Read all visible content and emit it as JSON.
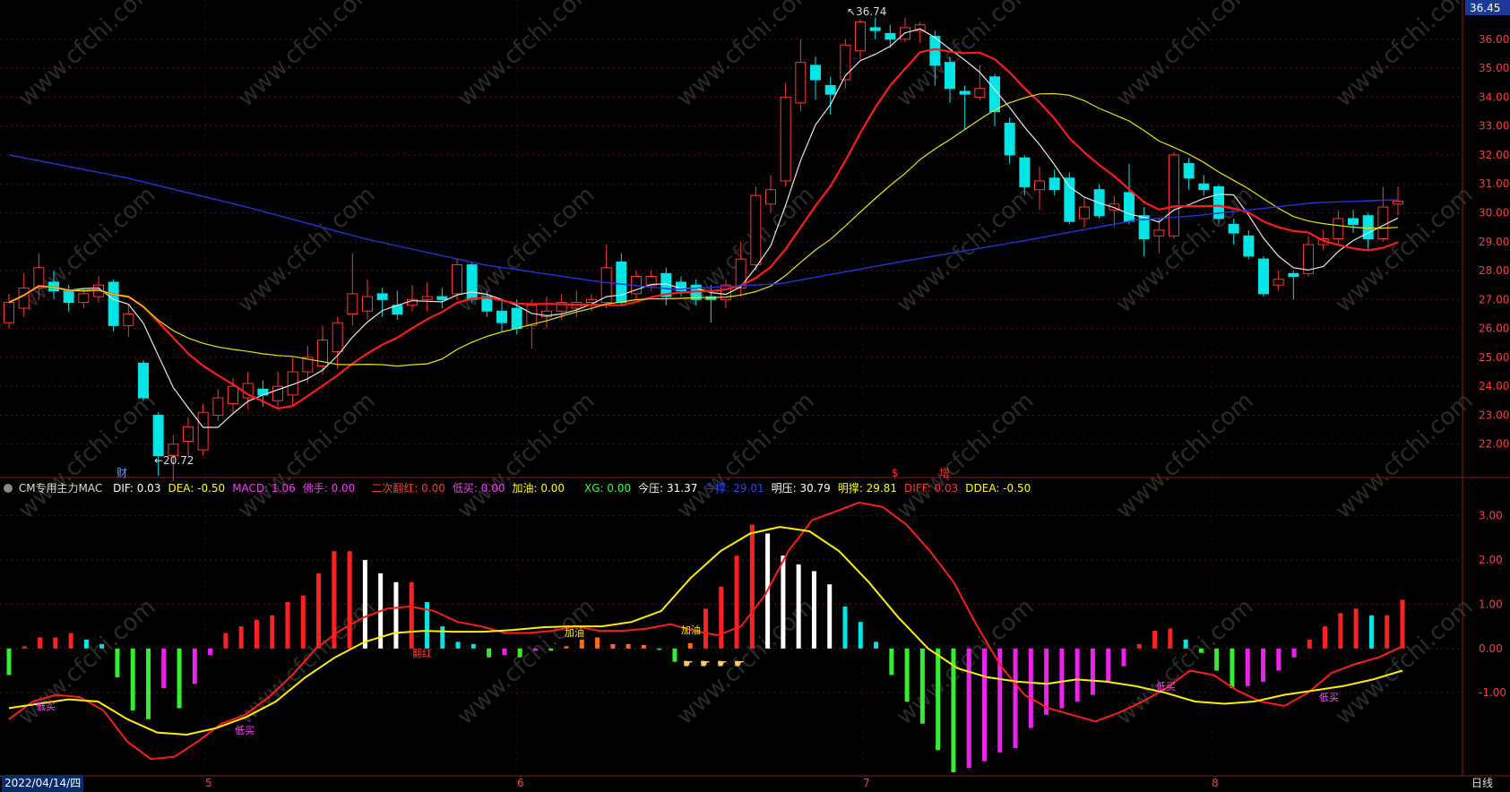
{
  "colors": {
    "up": "#ff3333",
    "down": "#00e5e5",
    "ma_white": "#e8e8e8",
    "ma_red": "#ff1a1a",
    "ma_yellow": "#e6e600",
    "ma_blue": "#2233dd",
    "grid": "#5a0f0f",
    "axis_text": "#ff3b3b"
  },
  "price_panel": {
    "current_price": "36.45",
    "y_ticks": [
      "36.00",
      "35.00",
      "34.00",
      "33.00",
      "32.00",
      "31.00",
      "30.00",
      "29.00",
      "28.00",
      "27.00",
      "26.00",
      "25.00",
      "24.00",
      "23.00",
      "22.00"
    ],
    "high_marker": "36.74",
    "low_marker": "20.72",
    "markers": [
      "财",
      "$",
      "增"
    ]
  },
  "indicator_panel": {
    "name": "CM专用主力MAC",
    "items": [
      {
        "label": "DIF: 0.03",
        "color": "#ffffff"
      },
      {
        "label": "DEA: -0.50",
        "color": "#ffff00"
      },
      {
        "label": "MACD: 1.06",
        "color": "#ff33ff"
      },
      {
        "label": "佛手: 0.00",
        "color": "#ff33ff"
      },
      {
        "label": "二次翻红: 0.00",
        "color": "#ff3333"
      },
      {
        "label": "低买: 0.00",
        "color": "#ff33ff"
      },
      {
        "label": "加油: 0.00",
        "color": "#ffff00"
      },
      {
        "label": "XG: 0.00",
        "color": "#33ff33"
      },
      {
        "label": "今压: 31.37",
        "color": "#ffffff"
      },
      {
        "label": "今撑: 29.01",
        "color": "#2244ff"
      },
      {
        "label": "明压: 30.79",
        "color": "#ffffff"
      },
      {
        "label": "明撑: 29.81",
        "color": "#ffff00"
      },
      {
        "label": "DIFF: 0.03",
        "color": "#ff3333"
      },
      {
        "label": "DDEA: -0.50",
        "color": "#ffff00"
      }
    ],
    "y_ticks": [
      "3.00",
      "2.00",
      "1.00",
      "0.00",
      "-1.00"
    ],
    "signals": [
      "低买",
      "低买",
      "翻红",
      "加油",
      "加油",
      "低买",
      "低买"
    ]
  },
  "footer": {
    "date": "2022/04/14/四",
    "months": [
      "5",
      "6",
      "7",
      "8"
    ],
    "period": "日线"
  },
  "watermark": "www.cfchi.com",
  "chart_data": {
    "type": "candlestick",
    "title": "",
    "price_ylim": [
      21.0,
      36.8
    ],
    "candles": [
      [
        26.2,
        26.9,
        27.2,
        26.0
      ],
      [
        26.7,
        27.4,
        27.9,
        26.4
      ],
      [
        27.4,
        28.1,
        28.6,
        27.0
      ],
      [
        27.6,
        27.3,
        28.0,
        27.0
      ],
      [
        27.3,
        26.9,
        27.5,
        26.6
      ],
      [
        26.9,
        27.2,
        27.4,
        26.7
      ],
      [
        27.1,
        27.5,
        27.8,
        26.9
      ],
      [
        27.6,
        26.1,
        27.7,
        25.9
      ],
      [
        26.1,
        26.5,
        26.8,
        25.7
      ],
      [
        24.8,
        23.6,
        24.9,
        23.5
      ],
      [
        23.0,
        21.6,
        23.1,
        20.9
      ],
      [
        21.6,
        22.0,
        22.3,
        20.72
      ],
      [
        22.1,
        22.6,
        22.9,
        21.6
      ],
      [
        21.8,
        23.1,
        23.4,
        21.6
      ],
      [
        23.0,
        23.6,
        23.9,
        22.8
      ],
      [
        23.4,
        24.0,
        24.3,
        23.1
      ],
      [
        23.6,
        24.1,
        24.5,
        23.2
      ],
      [
        23.9,
        23.7,
        24.2,
        23.3
      ],
      [
        23.5,
        24.0,
        24.5,
        23.2
      ],
      [
        23.7,
        24.5,
        25.0,
        23.3
      ],
      [
        24.5,
        25.0,
        25.4,
        24.1
      ],
      [
        24.7,
        25.6,
        26.1,
        24.4
      ],
      [
        25.2,
        26.2,
        26.4,
        24.6
      ],
      [
        26.5,
        27.2,
        28.6,
        26.1
      ],
      [
        26.6,
        27.1,
        27.7,
        26.3
      ],
      [
        27.2,
        27.0,
        27.4,
        26.4
      ],
      [
        26.8,
        26.5,
        27.3,
        26.3
      ],
      [
        26.8,
        27.0,
        27.5,
        26.6
      ],
      [
        27.0,
        27.1,
        27.6,
        26.6
      ],
      [
        27.1,
        27.0,
        27.4,
        26.7
      ],
      [
        27.2,
        28.2,
        28.4,
        27.0
      ],
      [
        28.2,
        27.0,
        28.3,
        26.9
      ],
      [
        27.1,
        26.6,
        27.3,
        26.4
      ],
      [
        26.6,
        26.2,
        27.0,
        25.9
      ],
      [
        26.7,
        26.0,
        27.0,
        25.8
      ],
      [
        26.1,
        26.8,
        27.0,
        25.3
      ],
      [
        26.4,
        26.6,
        27.1,
        26.0
      ],
      [
        26.6,
        26.9,
        27.2,
        26.3
      ],
      [
        26.7,
        26.9,
        27.3,
        26.4
      ],
      [
        26.9,
        27.0,
        27.2,
        26.6
      ],
      [
        26.9,
        28.1,
        28.9,
        26.7
      ],
      [
        28.3,
        26.9,
        28.6,
        26.8
      ],
      [
        27.2,
        27.8,
        28.0,
        27.0
      ],
      [
        27.5,
        27.8,
        28.0,
        27.3
      ],
      [
        27.9,
        27.1,
        28.1,
        26.8
      ],
      [
        27.6,
        27.3,
        27.8,
        27.1
      ],
      [
        27.5,
        27.0,
        27.7,
        26.8
      ],
      [
        27.1,
        27.0,
        27.5,
        26.2
      ],
      [
        27.0,
        27.5,
        27.7,
        26.7
      ],
      [
        27.4,
        28.4,
        29.0,
        27.1
      ],
      [
        28.2,
        30.6,
        30.9,
        28.0
      ],
      [
        30.3,
        30.8,
        31.3,
        30.0
      ],
      [
        31.1,
        34.0,
        34.5,
        30.9
      ],
      [
        33.8,
        35.2,
        36.0,
        33.5
      ],
      [
        35.1,
        34.6,
        35.4,
        33.9
      ],
      [
        34.4,
        34.1,
        34.7,
        33.4
      ],
      [
        34.6,
        35.8,
        36.0,
        34.3
      ],
      [
        35.6,
        36.6,
        36.7,
        35.3
      ],
      [
        36.4,
        36.3,
        36.74,
        36.0
      ],
      [
        36.2,
        36.0,
        36.5,
        35.7
      ],
      [
        36.0,
        36.4,
        36.74,
        35.9
      ],
      [
        36.3,
        36.5,
        36.6,
        35.9
      ],
      [
        36.1,
        35.1,
        36.3,
        34.4
      ],
      [
        35.2,
        34.3,
        35.4,
        33.8
      ],
      [
        34.2,
        34.1,
        34.4,
        32.9
      ],
      [
        34.0,
        34.3,
        35.1,
        33.9
      ],
      [
        34.7,
        33.5,
        34.8,
        33.0
      ],
      [
        33.1,
        32.0,
        33.3,
        31.7
      ],
      [
        31.9,
        30.9,
        32.0,
        30.6
      ],
      [
        30.8,
        31.1,
        31.6,
        30.1
      ],
      [
        31.2,
        30.8,
        31.5,
        30.6
      ],
      [
        31.2,
        29.7,
        31.4,
        29.6
      ],
      [
        29.8,
        30.2,
        30.5,
        29.5
      ],
      [
        30.8,
        29.9,
        31.0,
        29.8
      ],
      [
        30.1,
        30.3,
        30.6,
        29.5
      ],
      [
        30.7,
        29.7,
        31.7,
        29.6
      ],
      [
        29.9,
        29.1,
        30.2,
        28.5
      ],
      [
        29.2,
        29.4,
        29.8,
        28.6
      ],
      [
        29.2,
        32.0,
        32.1,
        29.1
      ],
      [
        31.7,
        31.2,
        31.9,
        30.8
      ],
      [
        31.0,
        30.8,
        31.3,
        30.6
      ],
      [
        30.9,
        29.8,
        31.0,
        29.6
      ],
      [
        29.6,
        29.3,
        29.8,
        28.9
      ],
      [
        29.2,
        28.5,
        29.4,
        28.4
      ],
      [
        28.4,
        27.2,
        28.5,
        27.1
      ],
      [
        27.5,
        27.7,
        28.0,
        27.3
      ],
      [
        27.9,
        27.8,
        28.0,
        27.0
      ],
      [
        27.9,
        28.9,
        29.2,
        27.8
      ],
      [
        28.9,
        29.1,
        29.4,
        28.7
      ],
      [
        29.1,
        29.8,
        30.1,
        28.9
      ],
      [
        29.8,
        29.6,
        30.1,
        29.3
      ],
      [
        29.9,
        29.1,
        30.0,
        28.7
      ],
      [
        29.1,
        30.2,
        30.9,
        29.0
      ],
      [
        30.3,
        30.4,
        30.9,
        29.9
      ]
    ],
    "ma_white_approx": "5-day MA",
    "ma_red_approx": "10-day MA",
    "ma_yellow_approx": "20-day MA",
    "ma_blue": [
      [
        0,
        32.0
      ],
      [
        10,
        31.2
      ],
      [
        20,
        30.2
      ],
      [
        30,
        29.1
      ],
      [
        40,
        28.2
      ],
      [
        50,
        27.6
      ],
      [
        56,
        27.35
      ],
      [
        65,
        27.55
      ],
      [
        75,
        28.3
      ],
      [
        85,
        29.0
      ],
      [
        95,
        29.75
      ],
      [
        100,
        29.9
      ],
      [
        110,
        30.35
      ],
      [
        117,
        30.45
      ]
    ],
    "indicator_ylim": [
      -2.8,
      3.4
    ],
    "macd_bars": [
      -0.6,
      0.05,
      0.25,
      0.25,
      0.35,
      0.2,
      0.1,
      -0.65,
      -1.4,
      -1.6,
      -0.9,
      -1.35,
      -0.8,
      -0.15,
      0.35,
      0.5,
      0.65,
      0.75,
      1.05,
      1.2,
      1.7,
      2.2,
      2.2,
      2.0,
      1.7,
      1.5,
      1.5,
      1.05,
      0.5,
      0.15,
      0.1,
      -0.2,
      -0.15,
      -0.2,
      -0.05,
      -0.05,
      0.05,
      0.2,
      0.25,
      0.1,
      0.1,
      0.08,
      -0.03,
      -0.3,
      0.12,
      0.9,
      1.4,
      2.1,
      2.8,
      2.6,
      2.1,
      1.9,
      1.75,
      1.45,
      0.95,
      0.6,
      0.15,
      -0.6,
      -1.2,
      -1.7,
      -2.3,
      -2.8,
      -2.7,
      -2.55,
      -2.35,
      -2.25,
      -1.8,
      -1.5,
      -1.35,
      -1.2,
      -1.05,
      -0.75,
      -0.4,
      0.1,
      0.4,
      0.45,
      0.2,
      -0.1,
      -0.5,
      -0.9,
      -0.85,
      -0.75,
      -0.5,
      -0.2,
      0.2,
      0.5,
      0.8,
      0.9,
      0.75,
      0.75,
      1.1
    ],
    "dif_line": [
      -1.6,
      -1.2,
      -1.05,
      -1.1,
      -1.4,
      -2.1,
      -2.5,
      -2.45,
      -2.1,
      -1.7,
      -1.5,
      -1.1,
      -0.6,
      0.0,
      0.4,
      0.7,
      0.9,
      0.95,
      0.85,
      0.6,
      0.5,
      0.35,
      0.35,
      0.4,
      0.5,
      0.4,
      0.4,
      0.45,
      0.55,
      0.4,
      0.3,
      0.5,
      1.2,
      2.2,
      2.9,
      3.1,
      3.3,
      3.2,
      2.8,
      2.2,
      1.5,
      0.5,
      -0.4,
      -1.05,
      -1.35,
      -1.5,
      -1.65,
      -1.45,
      -1.2,
      -0.9,
      -0.5,
      -0.6,
      -0.95,
      -1.2,
      -1.3,
      -1.0,
      -0.55,
      -0.35,
      -0.2,
      0.05
    ],
    "dea_line": [
      -1.35,
      -1.25,
      -1.15,
      -1.2,
      -1.6,
      -1.9,
      -1.95,
      -1.8,
      -1.55,
      -1.2,
      -0.65,
      -0.2,
      0.15,
      0.35,
      0.4,
      0.38,
      0.38,
      0.42,
      0.48,
      0.5,
      0.5,
      0.6,
      0.85,
      1.6,
      2.2,
      2.6,
      2.75,
      2.65,
      2.2,
      1.5,
      0.7,
      0.0,
      -0.45,
      -0.65,
      -0.75,
      -0.8,
      -0.7,
      -0.75,
      -0.85,
      -1.0,
      -1.2,
      -1.25,
      -1.2,
      -1.05,
      -0.95,
      -0.85,
      -0.7,
      -0.5
    ]
  }
}
